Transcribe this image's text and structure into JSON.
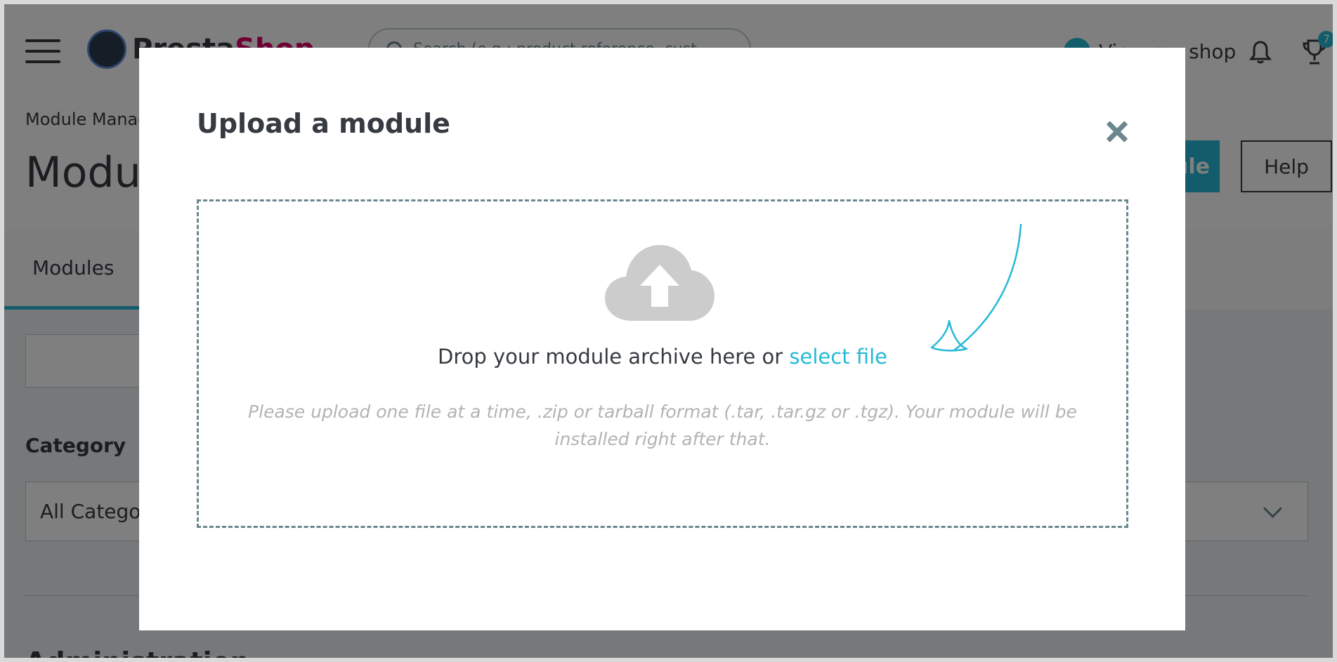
{
  "header": {
    "logo_text_a": "Presta",
    "logo_text_b": "Shop",
    "search_placeholder": "Search (e.g.: product reference, cust",
    "view_shop_label": "View my shop",
    "notifications_badge": "7"
  },
  "toolbar": {
    "breadcrumb": "Module Manager",
    "page_title": "Module manager",
    "upload_label": "Upload a module",
    "help_label": "Help"
  },
  "tabs": {
    "modules_label": "Modules"
  },
  "filters": {
    "category_label": "Category",
    "category_value": "All Categories"
  },
  "section": {
    "title": "Administration"
  },
  "modal": {
    "title": "Upload a module",
    "drop_text": "Drop your module archive here or",
    "select_file_label": "select file",
    "hint": "Please upload one file at a time, .zip or tarball format (.tar, .tar.gz or .tgz). Your module will be installed right after that."
  },
  "colors": {
    "accent": "#25b9d7",
    "text": "#363a41",
    "muted": "#b3b3b3",
    "dashed_border": "#6c868e",
    "icon_gray": "#cccccc"
  }
}
